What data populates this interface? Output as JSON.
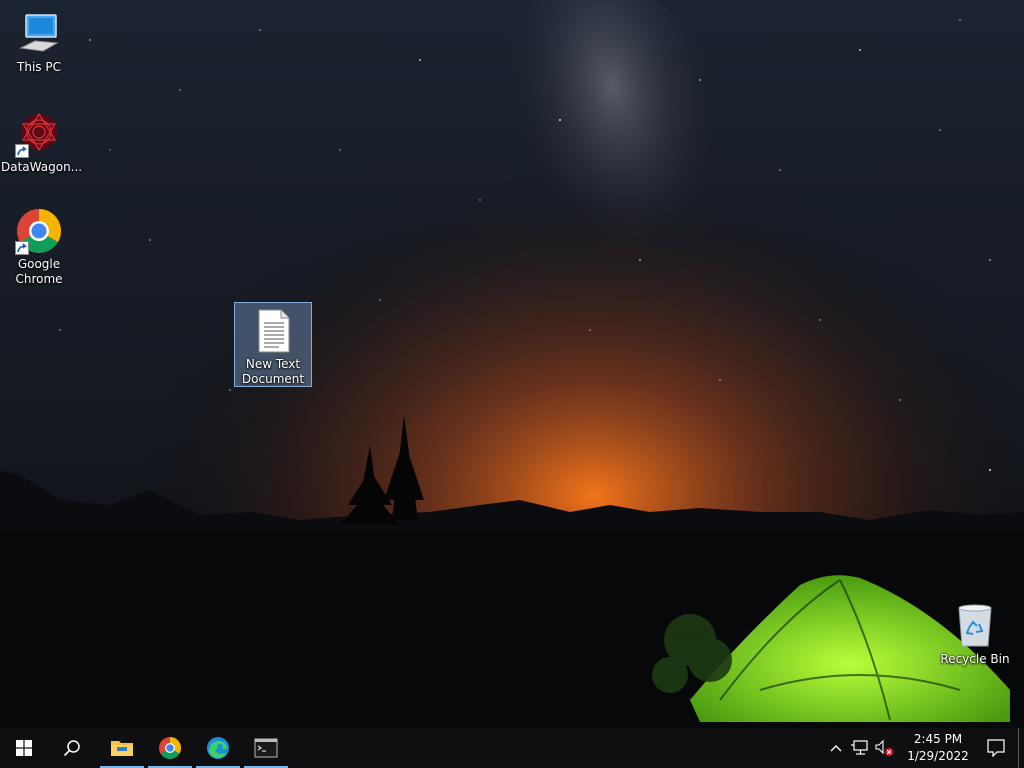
{
  "desktop": {
    "icons": [
      {
        "label": "This PC",
        "icon": "computer-icon"
      },
      {
        "label": "DataWagon...",
        "icon": "datawagon-icon"
      },
      {
        "label": "Google Chrome",
        "icon": "chrome-icon"
      },
      {
        "label": "New Text Document",
        "icon": "text-document-icon"
      },
      {
        "label": "Recycle Bin",
        "icon": "recycle-bin-icon"
      }
    ]
  },
  "taskbar": {
    "items": [
      {
        "name": "start",
        "icon": "windows-start-icon"
      },
      {
        "name": "search",
        "icon": "search-icon"
      },
      {
        "name": "file-explorer",
        "icon": "folder-icon"
      },
      {
        "name": "chrome",
        "icon": "chrome-icon"
      },
      {
        "name": "edge",
        "icon": "edge-icon"
      },
      {
        "name": "command-prompt",
        "icon": "terminal-icon"
      }
    ],
    "tray": {
      "time": "2:45 PM",
      "date": "1/29/2022"
    }
  },
  "colors": {
    "taskbar": "#0f0f12",
    "selection": "#99c9ff",
    "accent": "#76b9ed",
    "tent": "#8fe01e"
  }
}
